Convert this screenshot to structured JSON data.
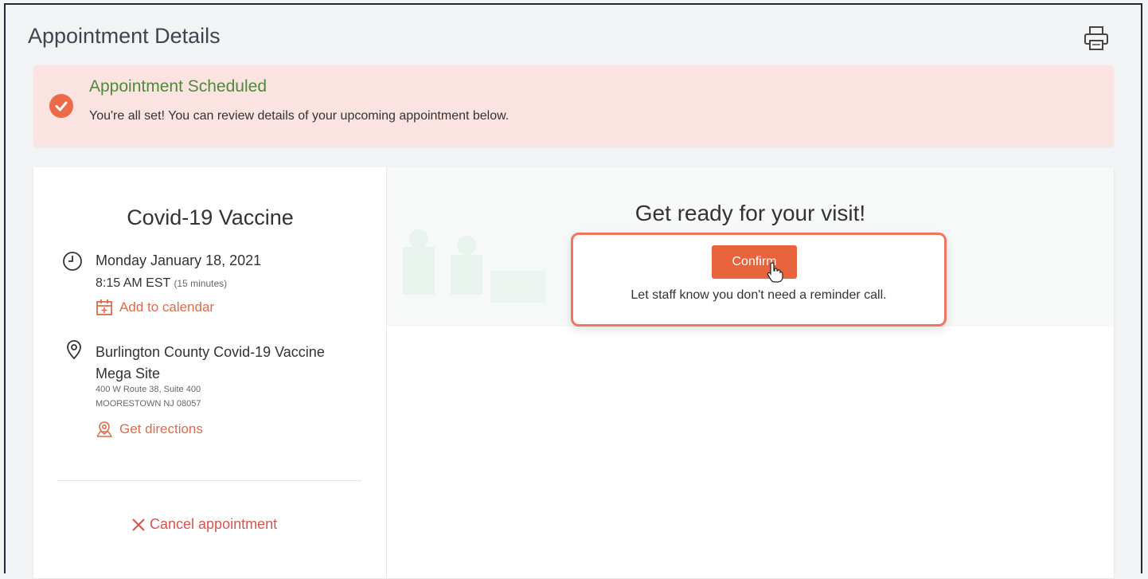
{
  "page": {
    "title": "Appointment Details"
  },
  "toolbar": {
    "print_icon": "printer-icon"
  },
  "alert": {
    "title": "Appointment Scheduled",
    "message": "You're all set! You can review details of your upcoming appointment below.",
    "icon": "check-circle-icon",
    "color": "#ec6a45"
  },
  "appointment": {
    "service": "Covid-19 Vaccine",
    "date": "Monday January 18, 2021",
    "time": "8:15 AM EST",
    "duration": "(15 minutes)",
    "add_to_calendar": "Add to calendar",
    "location_name": "Burlington County Covid-19 Vaccine Mega Site",
    "address_line1": "400 W Route 38, Suite 400",
    "address_line2": "MOORESTOWN NJ 08057",
    "get_directions": "Get directions",
    "cancel": "Cancel appointment"
  },
  "visit": {
    "title": "Get ready for your visit!",
    "confirm_label": "Confirm",
    "confirm_note": "Let staff know you don't need a reminder call."
  },
  "colors": {
    "accent": "#e8643c",
    "link": "#e06a4a",
    "success_text": "#4e8a3a",
    "alert_bg": "#fae3e1",
    "highlight_border": "#ef7560"
  }
}
